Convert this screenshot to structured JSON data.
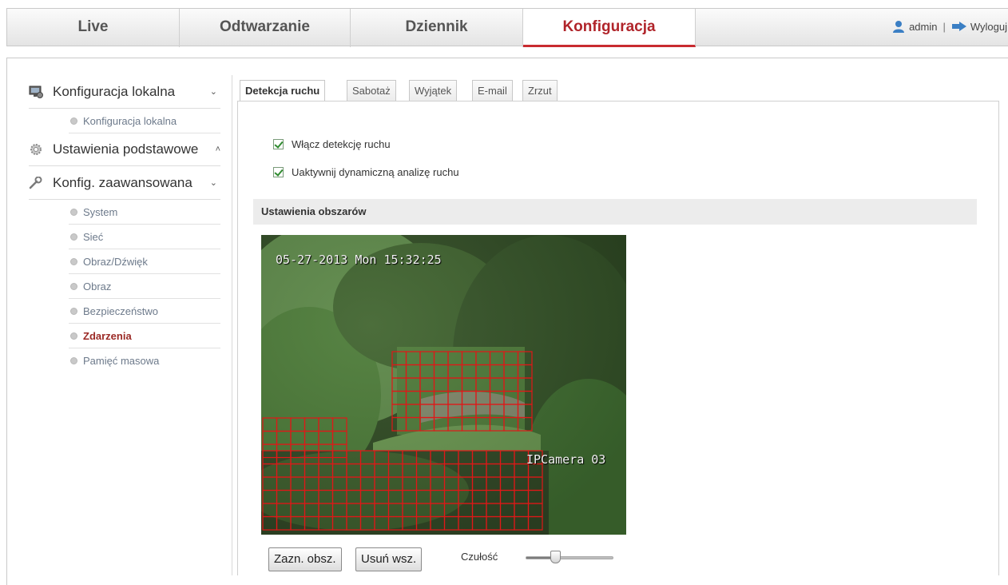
{
  "topnav": {
    "tabs": [
      {
        "label": "Live"
      },
      {
        "label": "Odtwarzanie"
      },
      {
        "label": "Dziennik"
      },
      {
        "label": "Konfiguracja",
        "active": true
      }
    ],
    "user": "admin",
    "separator": "|",
    "logout": "Wyloguj"
  },
  "sidebar": {
    "local": {
      "label": "Konfiguracja lokalna",
      "chevron": "⌄",
      "items": [
        "Konfiguracja lokalna"
      ]
    },
    "basic": {
      "label": "Ustawienia podstawowe",
      "chevron": "˄"
    },
    "advanced": {
      "label": "Konfig. zaawansowana",
      "chevron": "⌄",
      "items": [
        "System",
        "Sieć",
        "Obraz/Dźwięk",
        "Obraz",
        "Bezpieczeństwo",
        "Zdarzenia",
        "Pamięć masowa"
      ],
      "active_item": "Zdarzenia"
    }
  },
  "subtabs": [
    "Detekcja ruchu",
    "Sabotaż",
    "Wyjątek",
    "E-mail",
    "Zrzut"
  ],
  "motion": {
    "enable_label": "Włącz detekcję ruchu",
    "enable_checked": true,
    "dynamic_label": "Uaktywnij dynamiczną analizę ruchu",
    "dynamic_checked": true,
    "area_header": "Ustawienia obszarów",
    "osd_datetime": "05-27-2013 Mon 15:32:25",
    "osd_camera": "IPCamera 03",
    "draw_button": "Zazn. obsz.",
    "clear_button": "Usuń wsz.",
    "sensitivity_label": "Czułość",
    "sensitivity_level": 0.3
  },
  "colors": {
    "accent": "#c82b30",
    "grid": "#e01818"
  }
}
